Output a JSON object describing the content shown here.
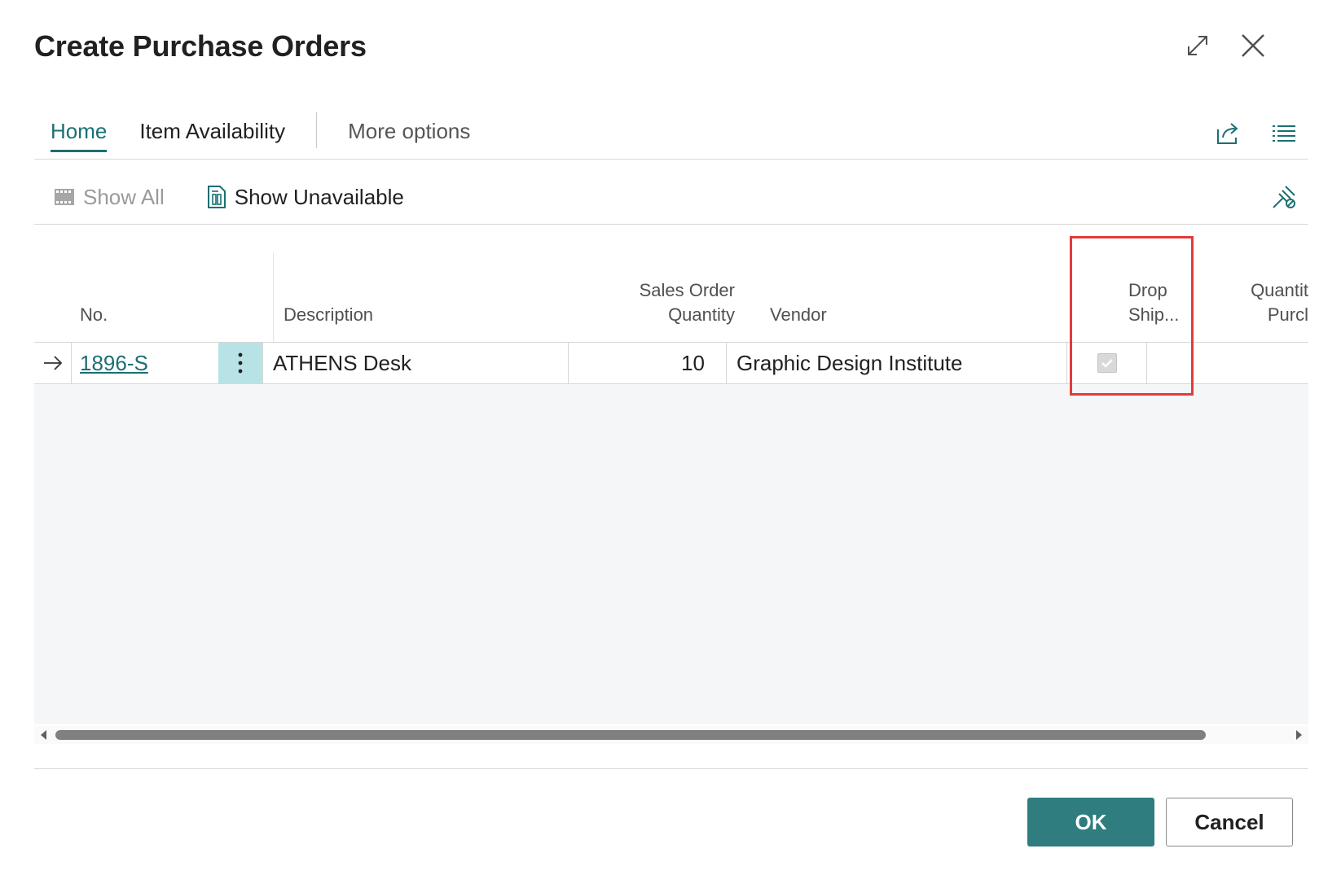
{
  "dialog": {
    "title": "Create Purchase Orders",
    "expand_icon": "expand-icon",
    "close_icon": "close-icon"
  },
  "tabs": [
    {
      "label": "Home",
      "active": true
    },
    {
      "label": "Item Availability",
      "active": false
    },
    {
      "label": "More options",
      "active": false
    }
  ],
  "toolbar_icons": {
    "share": "share-icon",
    "list_view": "list-view-icon",
    "pin": "pin-icon"
  },
  "actions": {
    "show_all": "Show All",
    "show_unavailable": "Show Unavailable"
  },
  "grid": {
    "headers": {
      "no": "No.",
      "description": "Description",
      "sales_order_quantity_line1": "Sales Order",
      "sales_order_quantity_line2": "Quantity",
      "vendor": "Vendor",
      "drop_ship_line1": "Drop",
      "drop_ship_line2": "Ship...",
      "quantity_purch_line1": "Quantit",
      "quantity_purch_line2": "Purcl"
    },
    "rows": [
      {
        "no": "1896-S",
        "description": "ATHENS Desk",
        "sales_order_quantity": "10",
        "vendor": "Graphic Design Institute",
        "drop_ship": true
      }
    ]
  },
  "footer": {
    "ok_label": "OK",
    "cancel_label": "Cancel"
  },
  "colors": {
    "accent": "#1b6f72",
    "primary_button": "#2f7d7e",
    "highlight_box": "#e23b3b",
    "selected_cell": "#b8e3e6"
  }
}
